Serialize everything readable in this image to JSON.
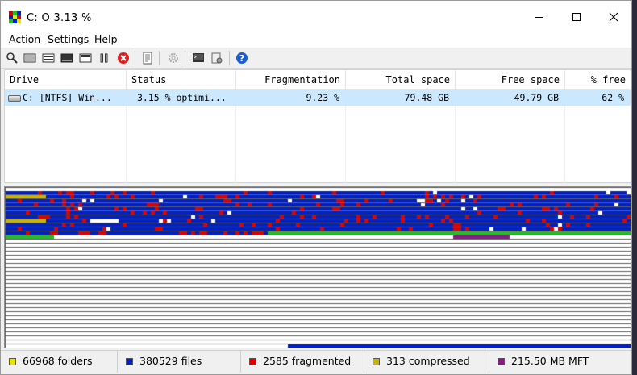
{
  "window": {
    "title": "C:  O  3.13 %"
  },
  "menu": {
    "action": "Action",
    "settings": "Settings",
    "help": "Help"
  },
  "list": {
    "columns": {
      "drive": "Drive",
      "status": "Status",
      "fragmentation": "Fragmentation",
      "total": "Total space",
      "free": "Free space",
      "pct_free": "% free"
    },
    "rows": [
      {
        "drive": "C: [NTFS]  Win...",
        "status": "3.15 % optimi...",
        "fragmentation": "9.23 %",
        "total": "79.48 GB",
        "free": "49.79 GB",
        "pct_free": "62 %"
      }
    ]
  },
  "status": {
    "folders": "66968 folders",
    "files": "380529 files",
    "fragmented": "2585 fragmented",
    "compressed": "313 compressed",
    "mft": "215.50 MB MFT"
  },
  "colors": {
    "folders": "#e6e600",
    "files": "#0020c8",
    "fragmented": "#e00000",
    "compressed": "#c8b400",
    "mft": "#8a1a8a",
    "optimized": "#20c020",
    "free": "#ffffff",
    "grid": "#606060",
    "selected_row": "#cce8ff"
  },
  "cluster_map": {
    "columns": 155,
    "rows": 40,
    "used_rows": 13,
    "bottom_files_fraction": 0.55
  }
}
